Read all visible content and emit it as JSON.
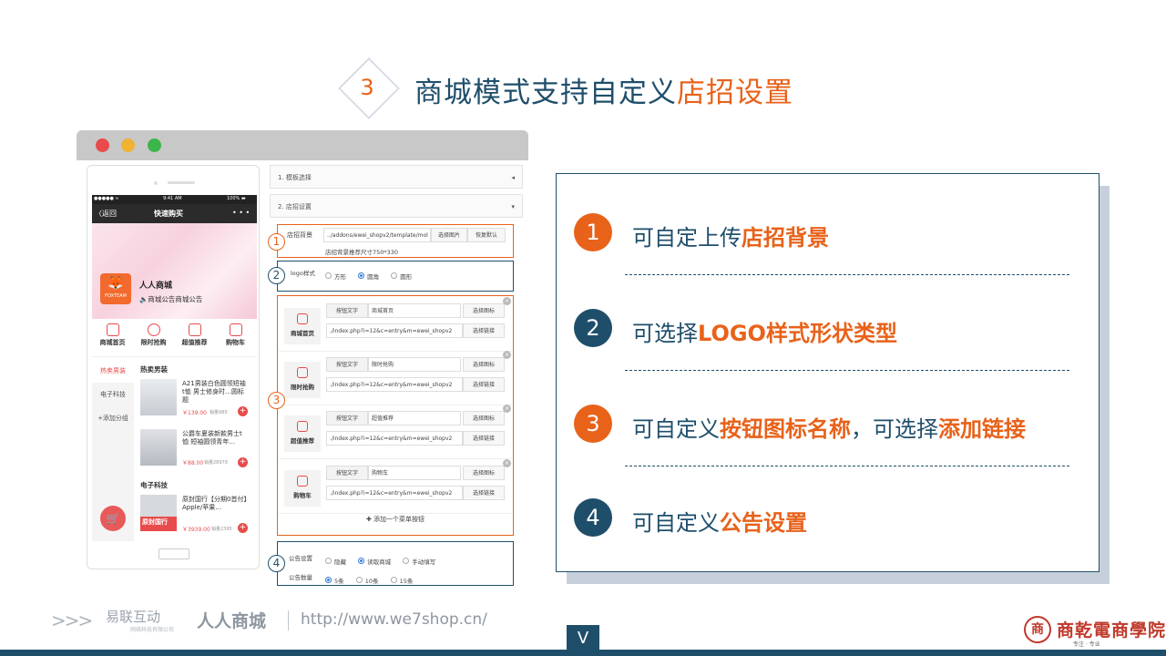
{
  "title": {
    "number": "3",
    "prefix": "商城模式支持自定义",
    "highlight": "店招设置"
  },
  "phone": {
    "status_left": "●●●●● ≈",
    "status_time": "9:41 AM",
    "status_battery": "100% ▬",
    "nav_back": "〈返回",
    "nav_title": "快速购买",
    "nav_more": "• • •",
    "shop_logo_text": "FOXTEAM",
    "shop_name": "人人商城",
    "notice": "商城公告商城公告",
    "menu": [
      "商城首页",
      "限时抢购",
      "超值推荐",
      "购物车"
    ],
    "side_cats": [
      "热卖男装",
      "电子科技",
      "+添加分组"
    ],
    "section1": "热卖男装",
    "section2": "电子科技",
    "products": [
      {
        "name": "A21男装白色圆领短袖t恤 男士修身时…圆标题",
        "price": "￥139.00",
        "sold": "销量989"
      },
      {
        "name": "公爵车夏装新款男士t恤 短袖圆领青年…",
        "price": "￥88.00",
        "sold": "销量28978"
      },
      {
        "name": "原封国行【分期0首付】Apple/苹果…",
        "price": "￥3939.00",
        "sold": "销量2395",
        "img_label": "原封国行"
      }
    ]
  },
  "panel": {
    "template_select": "1. 模板选择",
    "shop_settings": "2. 店招设置",
    "bg_label": "店招背景",
    "bg_value": "../addons/ewei_shopv2/template/mol",
    "bg_select_btn": "选择图片",
    "bg_restore_btn": "恢复默认",
    "bg_hint": "店招背景推荐尺寸750*330",
    "logo_style_label": "logo样式",
    "logo_options": [
      "方形",
      "圆角",
      "圆形"
    ],
    "menu_cards": [
      {
        "icon_label": "商城首页",
        "btn_text_label": "按钮文字",
        "btn_text": "商城首页",
        "link": "./index.php?i=12&c=entry&m=ewei_shopv2",
        "icon_btn": "选择图标",
        "link_btn": "选择链接"
      },
      {
        "icon_label": "限时抢购",
        "btn_text_label": "按钮文字",
        "btn_text": "限时抢购",
        "link": "./index.php?i=12&c=entry&m=ewei_shopv2",
        "icon_btn": "选择图标",
        "link_btn": "选择链接"
      },
      {
        "icon_label": "超值推荐",
        "btn_text_label": "按钮文字",
        "btn_text": "超值推荐",
        "link": "./index.php?i=12&c=entry&m=ewei_shopv2",
        "icon_btn": "选择图标",
        "link_btn": "选择链接"
      },
      {
        "icon_label": "购物车",
        "btn_text_label": "按钮文字",
        "btn_text": "购物车",
        "link": "./index.php?i=12&c=entry&m=ewei_shopv2",
        "icon_btn": "选择图标",
        "link_btn": "选择链接"
      }
    ],
    "add_menu_btn": "✚ 添加一个菜单按钮",
    "notice_label": "公告设置",
    "notice_options": [
      "隐藏",
      "读取商城",
      "手动填写"
    ],
    "notice_count_label": "公告数量",
    "notice_count_options": [
      "5条",
      "10条",
      "15条"
    ],
    "markers": [
      "1",
      "2",
      "3",
      "4"
    ]
  },
  "info": [
    {
      "num": "1",
      "text": "可自定上传",
      "hl": "店招背景",
      "suffix": ""
    },
    {
      "num": "2",
      "text": "可选择",
      "hl": "LOGO样式形状类型",
      "suffix": ""
    },
    {
      "num": "3",
      "text": "可自定义",
      "hl": "按钮图标名称",
      "mid": "，可选择",
      "hl2": "添加链接"
    },
    {
      "num": "4",
      "text": "可自定义",
      "hl": "公告设置",
      "suffix": ""
    }
  ],
  "footer": {
    "arrows": ">>>",
    "elogo": "易联互动",
    "elogo_sub": "网络科技有限公司",
    "rr_logo": "人人商城",
    "url": "http://www.we7shop.cn/",
    "down_arrow": "V",
    "right_logo_mark": "商",
    "right_name": "商乾電商學院",
    "right_sub": "专注 · 专业"
  },
  "colors": {
    "accent": "#e8621a",
    "primary": "#1f4e6b",
    "red": "#e84b4b"
  }
}
